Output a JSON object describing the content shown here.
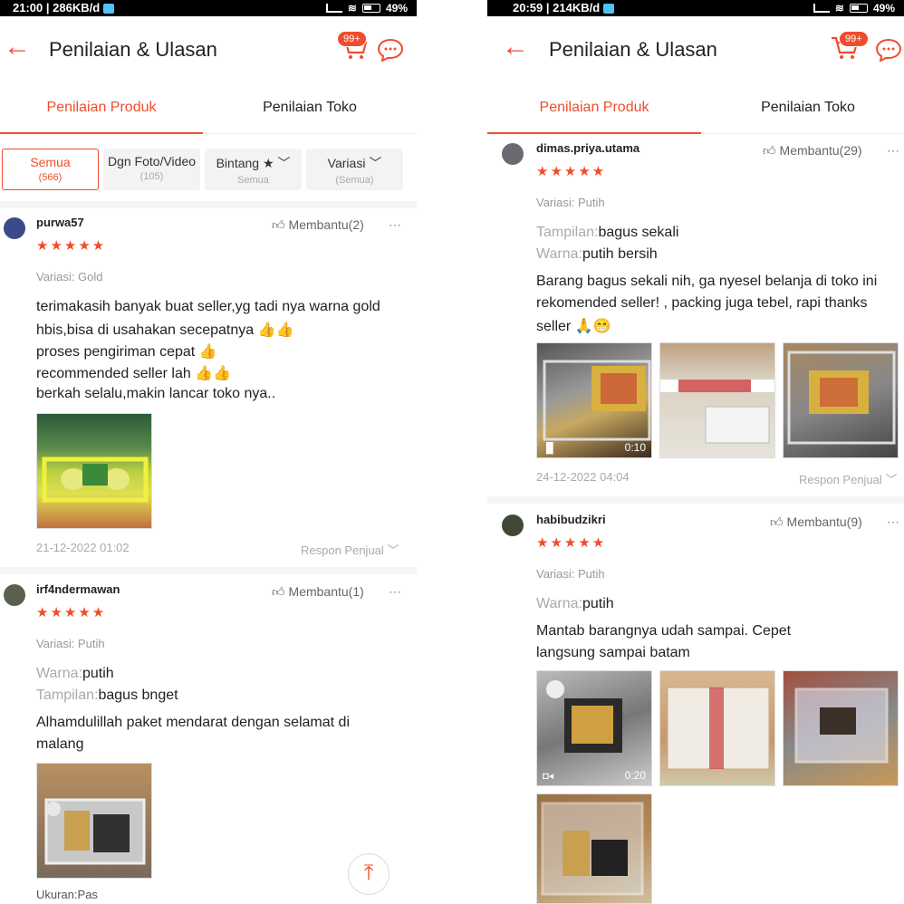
{
  "screens": [
    {
      "status": {
        "time": "21:00",
        "speed": "286KB/d",
        "battery": "49"
      },
      "header": {
        "title": "Penilaian & Ulasan",
        "cart_badge": "99+"
      },
      "tabs": [
        "Penilaian Produk",
        "Penilaian Toko"
      ],
      "filters": [
        {
          "label": "Semua",
          "sub": "(566)"
        },
        {
          "label": "Dgn Foto/Video",
          "sub": "(105)"
        },
        {
          "label": "Bintang ★",
          "sub": "Semua"
        },
        {
          "label": "Variasi",
          "sub": "(Semua)"
        }
      ],
      "reviews": [
        {
          "user": "purwa57",
          "helpful": "Membantu(2)",
          "rating": 5,
          "variant": "Variasi: Gold",
          "lines": [
            "terimakasih banyak buat seller,yg tadi nya warna gold",
            "hbis,bisa di usahakan secepatnya 👍👍",
            "proses pengiriman cepat 👍",
            "recommended seller lah 👍👍",
            "berkah selalu,makin lancar toko nya.."
          ],
          "date": "21-12-2022 01:02",
          "respon": "Respon Penjual"
        },
        {
          "user": "irf4ndermawan",
          "helpful": "Membantu(1)",
          "rating": 5,
          "variant": "Variasi: Putih",
          "kv": [
            {
              "k": "Warna:",
              "v": "putih"
            },
            {
              "k": "Tampilan:",
              "v": "bagus bnget"
            }
          ],
          "lines": [
            "Alhamdulillah paket mendarat dengan selamat di",
            "malang"
          ],
          "footer": "Ukuran:Pas"
        }
      ]
    },
    {
      "status": {
        "time": "20:59",
        "speed": "214KB/d",
        "battery": "49"
      },
      "header": {
        "title": "Penilaian & Ulasan",
        "cart_badge": "99+"
      },
      "tabs": [
        "Penilaian Produk",
        "Penilaian Toko"
      ],
      "reviews": [
        {
          "user": "dimas.priya.utama",
          "helpful": "Membantu(29)",
          "rating": 5,
          "variant": "Variasi: Putih",
          "kv": [
            {
              "k": "Tampilan:",
              "v": "bagus sekali"
            },
            {
              "k": "Warna:",
              "v": "putih bersih"
            }
          ],
          "lines": [
            "Barang bagus sekali nih, ga nyesel belanja di toko ini",
            "rekomended seller! , packing juga tebel, rapi thanks",
            "seller 🙏😁"
          ],
          "video_duration": "0:10",
          "date": "24-12-2022 04:04",
          "respon": "Respon Penjual"
        },
        {
          "user": "habibudzikri",
          "helpful": "Membantu(9)",
          "rating": 5,
          "variant": "Variasi: Putih",
          "kv": [
            {
              "k": "Warna:",
              "v": "putih"
            }
          ],
          "lines": [
            "Mantab barangnya udah sampai. Cepet",
            "langsung sampai batam"
          ],
          "video_duration": "0:20"
        }
      ]
    }
  ],
  "colors": {
    "accent": "#ee4d2d"
  }
}
